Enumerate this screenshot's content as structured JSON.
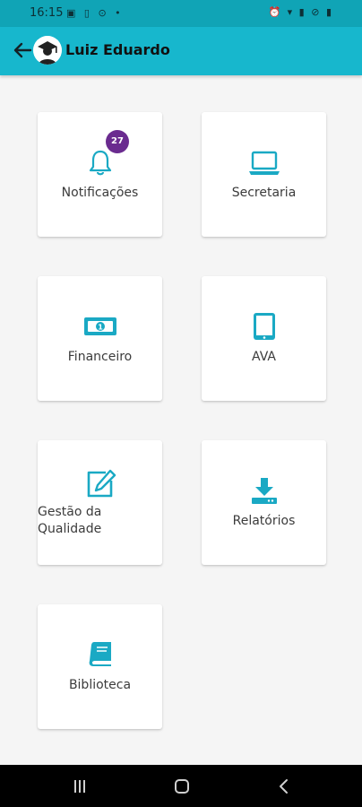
{
  "status_bar": {
    "time": "16:15",
    "left_icons": "▣ ▯ ⊙ •",
    "right_icons": "⏰ ▾ ▮ ⊘ ▮"
  },
  "app_bar": {
    "title": "Luiz Eduardo",
    "back_icon": "arrow-left-icon",
    "avatar_icon": "graduate-avatar-icon"
  },
  "menu": {
    "items": [
      {
        "label": "Notificações",
        "icon": "bell-icon",
        "badge": "27"
      },
      {
        "label": "Secretaria",
        "icon": "laptop-icon"
      },
      {
        "label": "Financeiro",
        "icon": "money-icon"
      },
      {
        "label": "AVA",
        "icon": "tablet-icon"
      },
      {
        "label_line1": "Gestão da",
        "label_line2": "Qualidade",
        "icon": "edit-icon"
      },
      {
        "label": "Relatórios",
        "icon": "download-icon"
      },
      {
        "label": "Biblioteca",
        "icon": "book-icon"
      }
    ]
  },
  "colors": {
    "accent": "#17b7cd",
    "status_bar": "#10a4b6",
    "icon": "#1aa9c4",
    "badge": "#6a2b8f"
  },
  "nav_bar": {
    "recents_icon": "recents-icon",
    "home_icon": "home-icon",
    "back_icon": "nav-back-icon"
  }
}
